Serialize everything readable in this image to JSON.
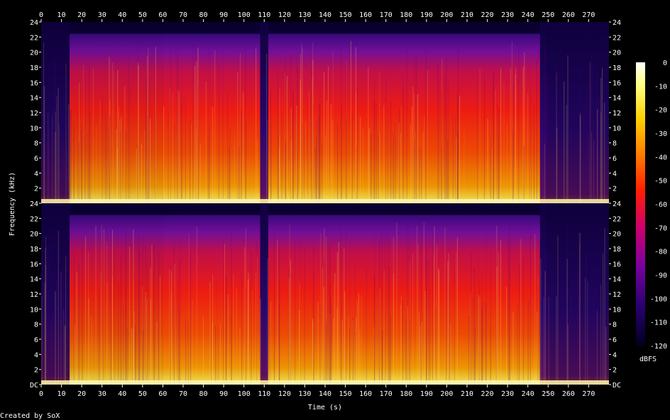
{
  "chart_data": {
    "type": "heatmap",
    "subtype": "spectrogram",
    "channels": 2,
    "xlabel": "Time (s)",
    "ylabel": "Frequency (kHz)",
    "xlim": [
      0,
      280
    ],
    "ylim_khz": [
      0,
      24
    ],
    "x_ticks": [
      0,
      10,
      20,
      30,
      40,
      50,
      60,
      70,
      80,
      90,
      100,
      110,
      120,
      130,
      140,
      150,
      160,
      170,
      180,
      190,
      200,
      210,
      220,
      230,
      240,
      250,
      260,
      270
    ],
    "y_ticks_upper": [
      "24",
      "22",
      "20",
      "18",
      "16",
      "14",
      "12",
      "10",
      "8",
      "6",
      "4",
      "2"
    ],
    "y_ticks_lower": [
      "24",
      "22",
      "20",
      "18",
      "16",
      "14",
      "12",
      "10",
      "8",
      "6",
      "4",
      "2",
      "DC"
    ],
    "colorbar": {
      "label": "dBFS",
      "range": [
        -120,
        0
      ],
      "ticks": [
        "0",
        "-10",
        "-20",
        "-30",
        "-40",
        "-50",
        "-60",
        "-70",
        "-80",
        "-90",
        "-100",
        "-110",
        "-120"
      ],
      "colors": [
        "#ffffff",
        "#ffff80",
        "#ffd000",
        "#ff8000",
        "#ff2000",
        "#d0006a",
        "#7a00a0",
        "#2a0070",
        "#000020"
      ]
    },
    "energy_profile": {
      "description_units": "approximate loudness segments (seconds, relative level 0-1)",
      "segments": [
        {
          "start": 0,
          "end": 14,
          "level": 0.25
        },
        {
          "start": 14,
          "end": 60,
          "level": 0.85
        },
        {
          "start": 60,
          "end": 108,
          "level": 0.9
        },
        {
          "start": 108,
          "end": 112,
          "level": 0.5
        },
        {
          "start": 112,
          "end": 246,
          "level": 0.9
        },
        {
          "start": 246,
          "end": 249,
          "level": 0.5
        },
        {
          "start": 249,
          "end": 280,
          "level": 0.3
        }
      ]
    }
  },
  "footer": {
    "credit": "Created by SoX"
  }
}
